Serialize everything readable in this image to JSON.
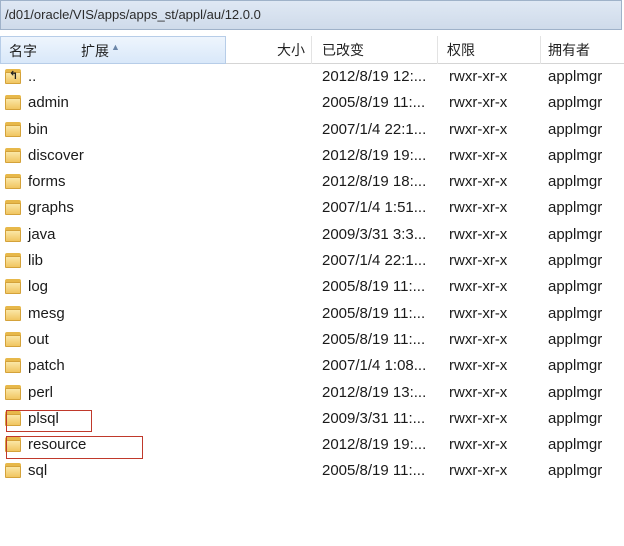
{
  "path_bar": {
    "path": "/d01/oracle/VIS/apps/apps_st/appl/au/12.0.0"
  },
  "columns": {
    "name": "名字",
    "ext": "扩展",
    "size": "大小",
    "modified": "已改变",
    "permissions": "权限",
    "owner": "拥有者"
  },
  "rows": [
    {
      "name": "..",
      "modified": "2012/8/19 12:...",
      "permissions": "rwxr-xr-x",
      "owner": "applmgr",
      "icon": "folder-up-icon"
    },
    {
      "name": "admin",
      "modified": "2005/8/19 11:...",
      "permissions": "rwxr-xr-x",
      "owner": "applmgr",
      "icon": "folder-icon"
    },
    {
      "name": "bin",
      "modified": "2007/1/4 22:1...",
      "permissions": "rwxr-xr-x",
      "owner": "applmgr",
      "icon": "folder-icon"
    },
    {
      "name": "discover",
      "modified": "2012/8/19 19:...",
      "permissions": "rwxr-xr-x",
      "owner": "applmgr",
      "icon": "folder-icon"
    },
    {
      "name": "forms",
      "modified": "2012/8/19 18:...",
      "permissions": "rwxr-xr-x",
      "owner": "applmgr",
      "icon": "folder-icon"
    },
    {
      "name": "graphs",
      "modified": "2007/1/4 1:51...",
      "permissions": "rwxr-xr-x",
      "owner": "applmgr",
      "icon": "folder-icon"
    },
    {
      "name": "java",
      "modified": "2009/3/31 3:3...",
      "permissions": "rwxr-xr-x",
      "owner": "applmgr",
      "icon": "folder-icon"
    },
    {
      "name": "lib",
      "modified": "2007/1/4 22:1...",
      "permissions": "rwxr-xr-x",
      "owner": "applmgr",
      "icon": "folder-icon"
    },
    {
      "name": "log",
      "modified": "2005/8/19 11:...",
      "permissions": "rwxr-xr-x",
      "owner": "applmgr",
      "icon": "folder-icon"
    },
    {
      "name": "mesg",
      "modified": "2005/8/19 11:...",
      "permissions": "rwxr-xr-x",
      "owner": "applmgr",
      "icon": "folder-icon"
    },
    {
      "name": "out",
      "modified": "2005/8/19 11:...",
      "permissions": "rwxr-xr-x",
      "owner": "applmgr",
      "icon": "folder-icon"
    },
    {
      "name": "patch",
      "modified": "2007/1/4 1:08...",
      "permissions": "rwxr-xr-x",
      "owner": "applmgr",
      "icon": "folder-icon"
    },
    {
      "name": "perl",
      "modified": "2012/8/19 13:...",
      "permissions": "rwxr-xr-x",
      "owner": "applmgr",
      "icon": "folder-icon"
    },
    {
      "name": "plsql",
      "modified": "2009/3/31 11:...",
      "permissions": "rwxr-xr-x",
      "owner": "applmgr",
      "icon": "folder-icon"
    },
    {
      "name": "resource",
      "modified": "2012/8/19 19:...",
      "permissions": "rwxr-xr-x",
      "owner": "applmgr",
      "icon": "folder-icon"
    },
    {
      "name": "sql",
      "modified": "2005/8/19 11:...",
      "permissions": "rwxr-xr-x",
      "owner": "applmgr",
      "icon": "folder-icon"
    }
  ],
  "annotation_color": "#c0392b"
}
